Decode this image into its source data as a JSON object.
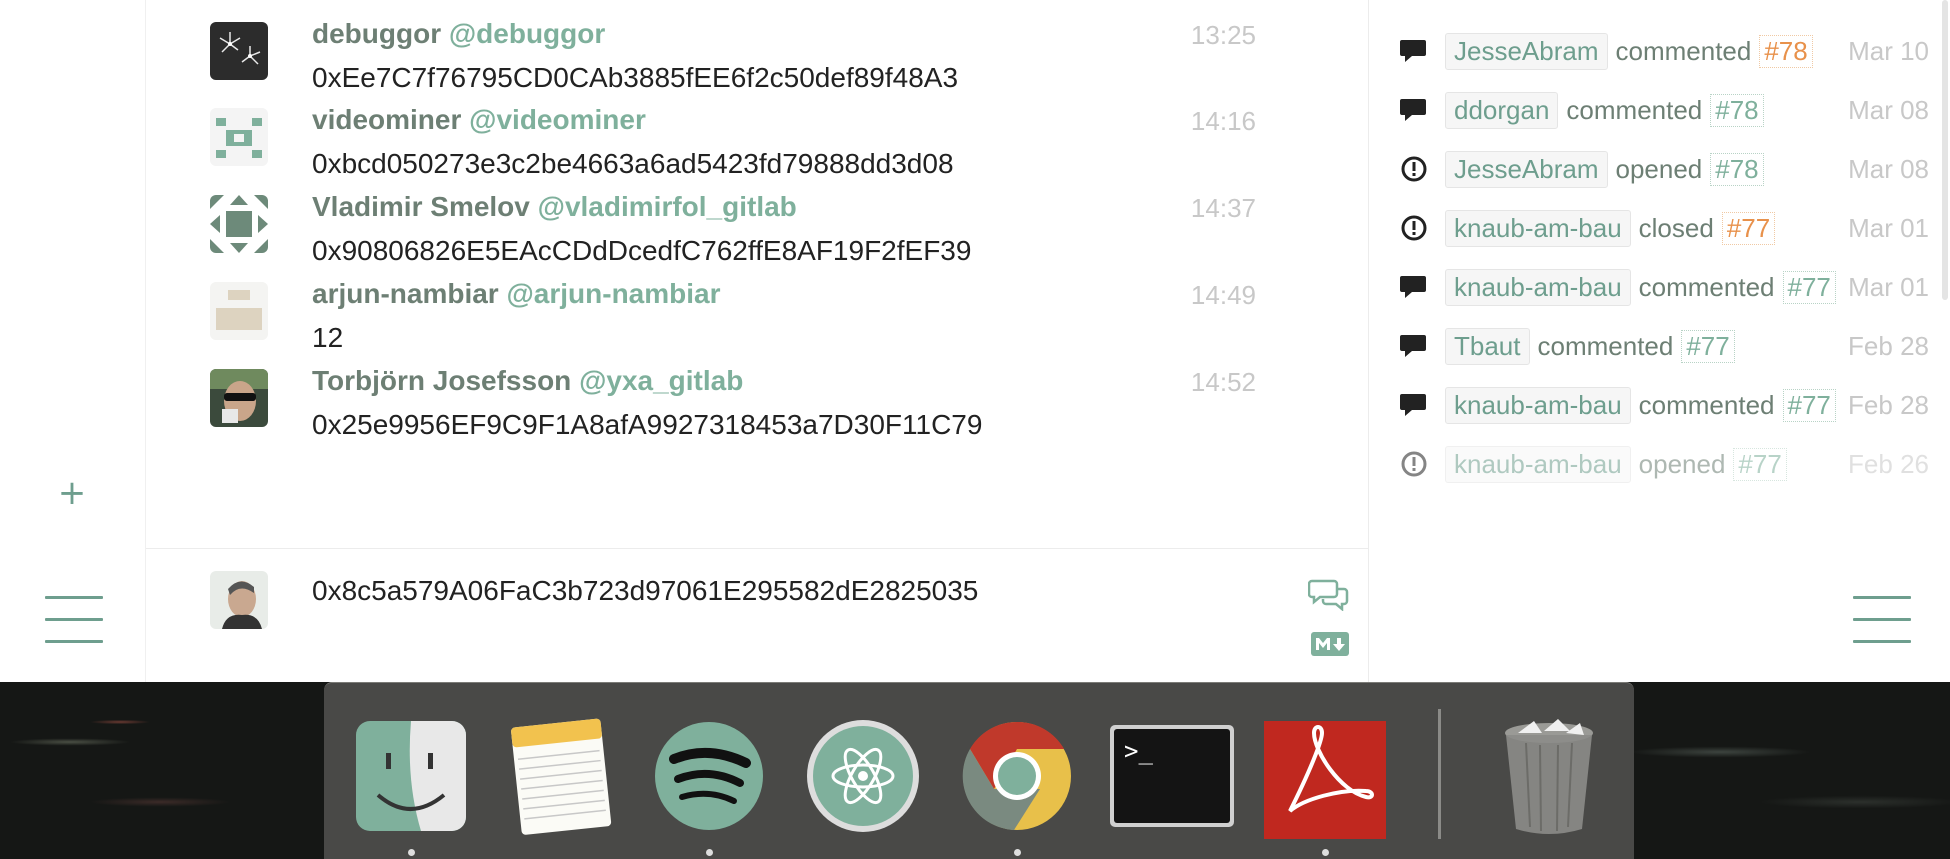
{
  "messages": [
    {
      "name": "debuggor",
      "handle": "@debuggor",
      "text": "0xEe7C7f76795CD0CAb3885fEE6f2c50def89f48A3",
      "time": "13:25"
    },
    {
      "name": "videominer",
      "handle": "@videominer",
      "text": "0xbcd050273e3c2be4663a6ad5423fd79888dd3d08",
      "time": "14:16"
    },
    {
      "name": "Vladimir Smelov",
      "handle": "@vladimirfol_gitlab",
      "text": "0x90806826E5EAcCDdDcedfC762ffE8AF19F2fEF39",
      "time": "14:37"
    },
    {
      "name": "arjun-nambiar",
      "handle": "@arjun-nambiar",
      "text": "12",
      "time": "14:49"
    },
    {
      "name": "Torbjörn Josefsson",
      "handle": "@yxa_gitlab",
      "text": "0x25e9956EF9C9F1A8afA9927318453a7D30F11C79",
      "time": "14:52"
    }
  ],
  "composer": {
    "value": "0x8c5a579A06FaC3b723d97061E295582dE2825035"
  },
  "left_rail": {
    "add_label": "+"
  },
  "activity": [
    {
      "icon": "comment-icon",
      "user": "JesseAbram",
      "verb": "commented",
      "issue": "#78",
      "issue_color": "#e8914b",
      "date": "Mar 10"
    },
    {
      "icon": "comment-icon",
      "user": "ddorgan",
      "verb": "commented",
      "issue": "#78",
      "issue_color": "#7fb09c",
      "date": "Mar 08"
    },
    {
      "icon": "issue-icon",
      "user": "JesseAbram",
      "verb": "opened",
      "issue": "#78",
      "issue_color": "#7fb09c",
      "date": "Mar 08"
    },
    {
      "icon": "issue-icon",
      "user": "knaub-am-bau",
      "verb": "closed",
      "issue": "#77",
      "issue_color": "#e8914b",
      "date": "Mar 01"
    },
    {
      "icon": "comment-icon",
      "user": "knaub-am-bau",
      "verb": "commented",
      "issue": "#77",
      "issue_color": "#7fb09c",
      "date": "Mar 01"
    },
    {
      "icon": "comment-icon",
      "user": "Tbaut",
      "verb": "commented",
      "issue": "#77",
      "issue_color": "#7fb09c",
      "date": "Feb 28"
    },
    {
      "icon": "comment-icon",
      "user": "knaub-am-bau",
      "verb": "commented",
      "issue": "#77",
      "issue_color": "#7fb09c",
      "date": "Feb 28"
    },
    {
      "icon": "issue-icon",
      "user": "knaub-am-bau",
      "verb": "opened",
      "issue": "#77",
      "issue_color": "#7fb09c",
      "date": "Feb 26"
    }
  ],
  "dock": {
    "apps": [
      "Finder",
      "Notes",
      "Spotify",
      "Atom",
      "Chrome",
      "Terminal",
      "Acrobat",
      "Trash"
    ],
    "running": [
      "Finder",
      "Spotify",
      "Chrome",
      "Acrobat"
    ],
    "terminal_prompt": ">_"
  },
  "colors": {
    "accent": "#6e9e8e",
    "handle": "#7fb09c",
    "name": "#6d7f74",
    "orange": "#e8914b"
  }
}
